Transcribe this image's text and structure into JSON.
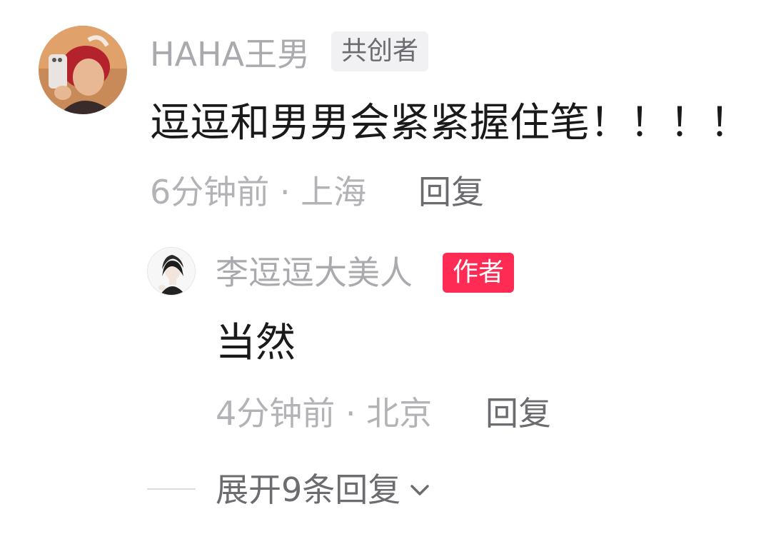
{
  "comment": {
    "username": "HAHA王男",
    "badge": "共创者",
    "text": "逗逗和男男会紧紧握住笔！！！！",
    "meta": "6分钟前 · 上海",
    "reply_label": "回复",
    "avatar_icon": "user-avatar-photo"
  },
  "reply": {
    "username": "李逗逗大美人",
    "badge": "作者",
    "text": "当然",
    "meta": "4分钟前 · 北京",
    "reply_label": "回复",
    "avatar_icon": "author-avatar-illustration"
  },
  "expand": {
    "label": "展开9条回复",
    "icon": "chevron-down-icon"
  },
  "colors": {
    "author_badge": "#fe2c55",
    "cocreator_badge_bg": "#f1f1f3",
    "muted_text": "#a9a9ae",
    "primary_text": "#1a1a1a"
  }
}
